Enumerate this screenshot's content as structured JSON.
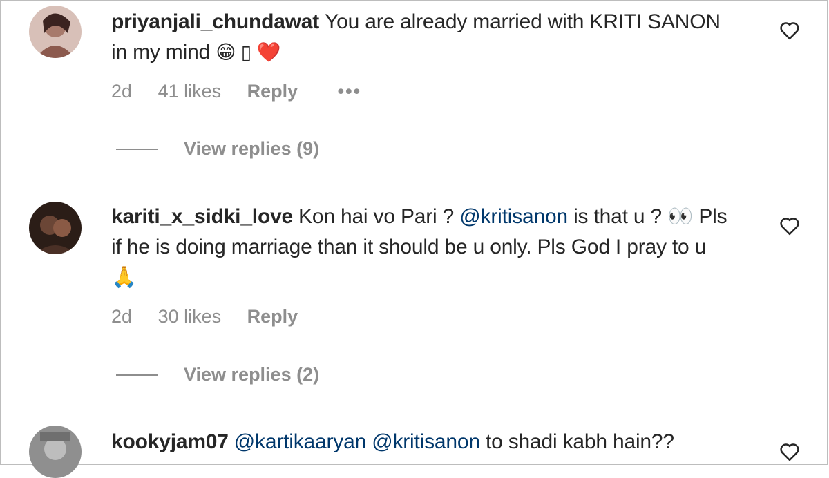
{
  "comments": [
    {
      "username": "priyanjali_chundawat",
      "text_before": "You are already married with KRITI SANON in my mind",
      "emojis": "😁 ▯ ❤️",
      "time": "2d",
      "likes": "41 likes",
      "reply": "Reply",
      "more": "•••",
      "view_replies": "View replies (9)",
      "avatar_color": "#c9a9a0"
    },
    {
      "username": "kariti_x_sidki_love",
      "text_before": "Kon hai vo Pari ?",
      "mention": "@kritisanon",
      "text_after": "is that u ? 👀 Pls if he is doing marriage than it should be u only. Pls God I pray to u 🙏",
      "time": "2d",
      "likes": "30 likes",
      "reply": "Reply",
      "view_replies": "View replies (2)",
      "avatar_color": "#3a2a22"
    },
    {
      "username": "kookyjam07",
      "mention1": "@kartikaaryan",
      "mention2": "@kritisanon",
      "text_after": "to shadi kabh hain??",
      "avatar_color": "#9a9a9a"
    }
  ],
  "colors": {
    "text": "#262626",
    "muted": "#8e8e8e",
    "mention": "#00376b",
    "heart_emoji": "#e0245e"
  }
}
